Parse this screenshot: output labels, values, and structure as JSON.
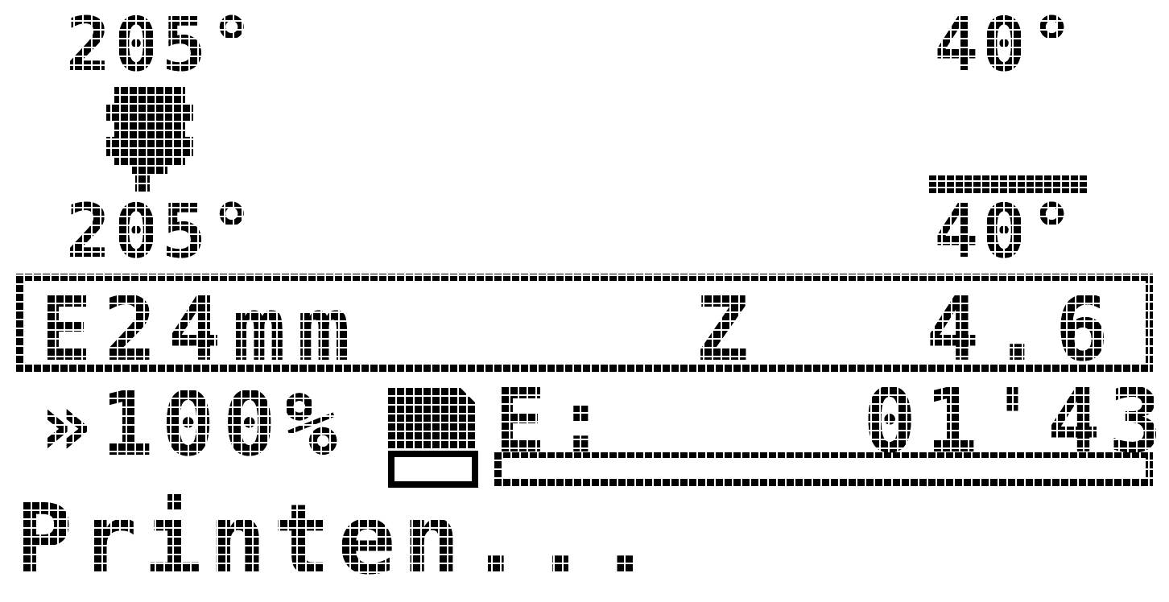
{
  "hotend": {
    "current": "205°",
    "target": "205°"
  },
  "bed": {
    "current": "40°",
    "target": "40°"
  },
  "position": {
    "e_label": "E24mm",
    "z_label": "Z",
    "z_value": "4.6"
  },
  "feedrate": {
    "icon": "feedrate-arrow-icon",
    "value": "»100%"
  },
  "sd": {
    "icon": "sd-card-icon"
  },
  "elapsed": {
    "label": "E:",
    "value": "01'43"
  },
  "progress": {
    "percent": 0
  },
  "status": {
    "message": "Printen..."
  },
  "colors": {
    "pixel": "#000000",
    "background": "#ffffff"
  }
}
